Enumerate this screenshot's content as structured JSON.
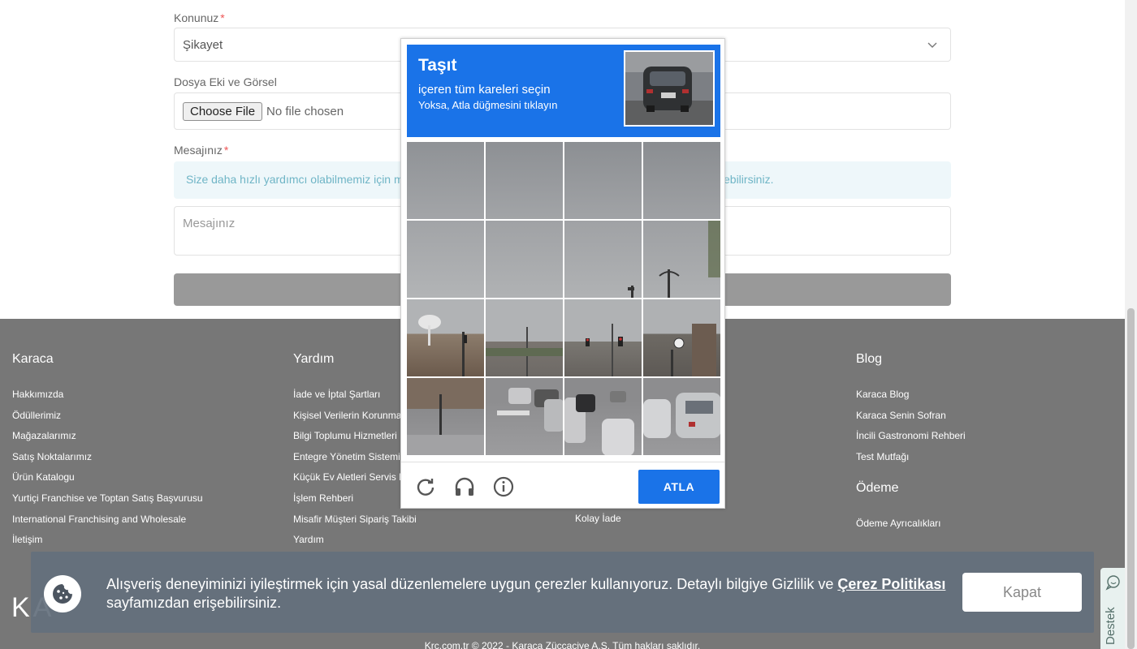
{
  "form": {
    "subject_label": "Konunuz",
    "subject_value": "Şikayet",
    "attachment_label": "Dosya Eki ve Görsel",
    "choose_file": "Choose File",
    "no_file": "No file chosen",
    "message_label": "Mesajınız",
    "info_text_start": "Size daha hızlı yardımcı olabilmemiz için me",
    "info_text_end": "ebilirsiniz.",
    "message_placeholder": "Mesajınız",
    "required_mark": "*"
  },
  "captcha": {
    "title": "Taşıt",
    "subtitle": "içeren tüm kareleri seçin",
    "instruction": "Yoksa, Atla düğmesini tıklayın",
    "skip_label": "ATLA",
    "icons": [
      "reload-icon",
      "headphones-icon",
      "info-icon"
    ]
  },
  "footer": {
    "col_karaca": {
      "title": "Karaca",
      "items": [
        "Hakkımızda",
        "Ödüllerimiz",
        "Mağazalarımız",
        "Satış Noktalarımız",
        "Ürün Katalogu",
        "Yurtiçi Franchise ve Toptan Satış Başvurusu",
        "International Franchising and Wholesale",
        "İletişim"
      ]
    },
    "col_yardim": {
      "title": "Yardım",
      "items": [
        "İade ve İptal Şartları",
        "Kişisel Verilerin Korunma",
        "Bilgi Toplumu Hizmetleri",
        "Entegre Yönetim Sistemi",
        "Küçük Ev Aletleri Servis N",
        "İşlem Rehberi",
        "Misafir Müşteri Sipariş Takibi",
        "Yardım"
      ]
    },
    "col_third": {
      "items": [
        "Kolay İade"
      ]
    },
    "col_blog": {
      "title": "Blog",
      "items": [
        "Karaca Blog",
        "Karaca Senin Sofran",
        "İncili Gastronomi Rehberi",
        "Test Mutfağı"
      ],
      "payment_title": "Ödeme",
      "payment_items": [
        "Ödeme Ayrıcalıkları"
      ]
    },
    "logo_partial": "KA",
    "copyright": "Krc.com.tr © 2022 - Karaca Züccaciye A.S. Tüm hakları saklıdır."
  },
  "cookie": {
    "text": "Alışveriş deneyiminizi iyileştirmek için yasal düzenlemelere uygun çerezler kullanıyoruz. Detaylı bilgiye Gizlilik ve ",
    "link": "Çerez Politikası",
    "text_end": " sayfamızdan erişebilirsiniz.",
    "close_label": "Kapat"
  },
  "support": {
    "label": "Destek"
  },
  "colors": {
    "captcha_blue": "#1a73e8",
    "footer_bg": "#777777",
    "cookie_bg": "#64707d",
    "info_bg": "#eef7fa"
  }
}
